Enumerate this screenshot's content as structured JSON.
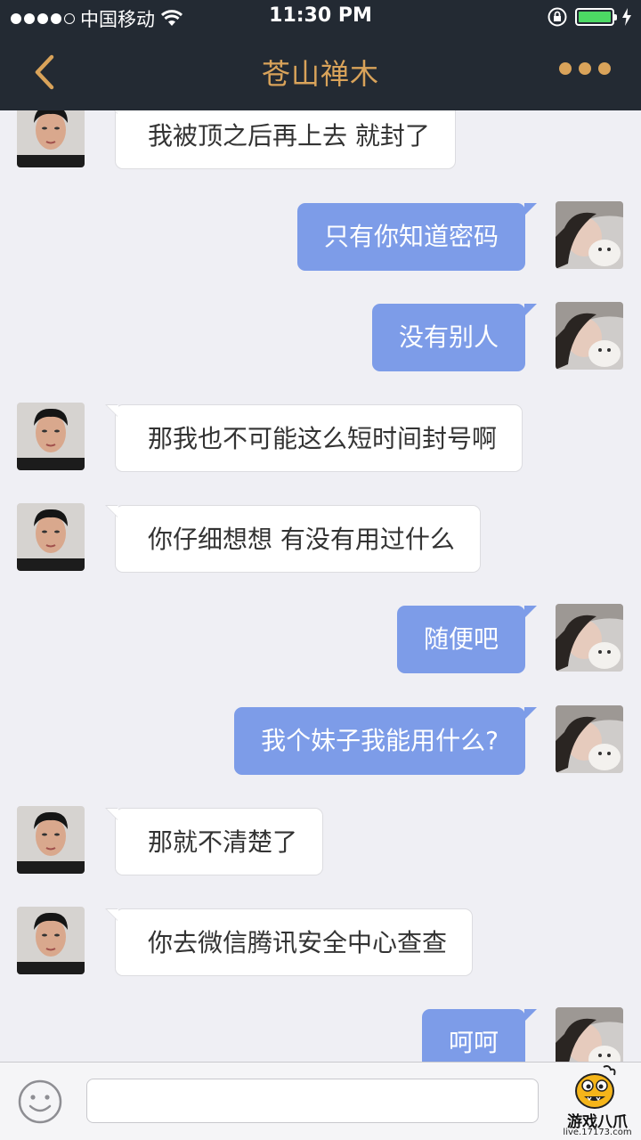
{
  "status_bar": {
    "carrier": "中国移动",
    "time": "11:30 PM"
  },
  "nav": {
    "title": "苍山禅木",
    "back_icon": "chevron-left-icon",
    "more_icon": "more-dots-icon"
  },
  "messages": [
    {
      "side": "left",
      "text": "我被顶之后再上去 就封了"
    },
    {
      "side": "right",
      "text": "只有你知道密码"
    },
    {
      "side": "right",
      "text": "没有别人"
    },
    {
      "side": "left",
      "text": "那我也不可能这么短时间封号啊"
    },
    {
      "side": "left",
      "text": "你仔细想想 有没有用过什么"
    },
    {
      "side": "right",
      "text": "随便吧"
    },
    {
      "side": "right",
      "text": "我个妹子我能用什么?"
    },
    {
      "side": "left",
      "text": "那就不清楚了"
    },
    {
      "side": "left",
      "text": "你去微信腾讯安全中心查查"
    },
    {
      "side": "right",
      "text": "呵呵"
    }
  ],
  "input_bar": {
    "emoji_icon": "emoji-icon",
    "input_value": ""
  },
  "watermark": {
    "brand": "游戏八爪",
    "url": "live.17173.com"
  },
  "colors": {
    "nav_bg": "#232a33",
    "accent": "#d9a35a",
    "outgoing_bubble": "#7d9ce8",
    "incoming_bubble": "#ffffff",
    "chat_bg": "#efeff4"
  }
}
